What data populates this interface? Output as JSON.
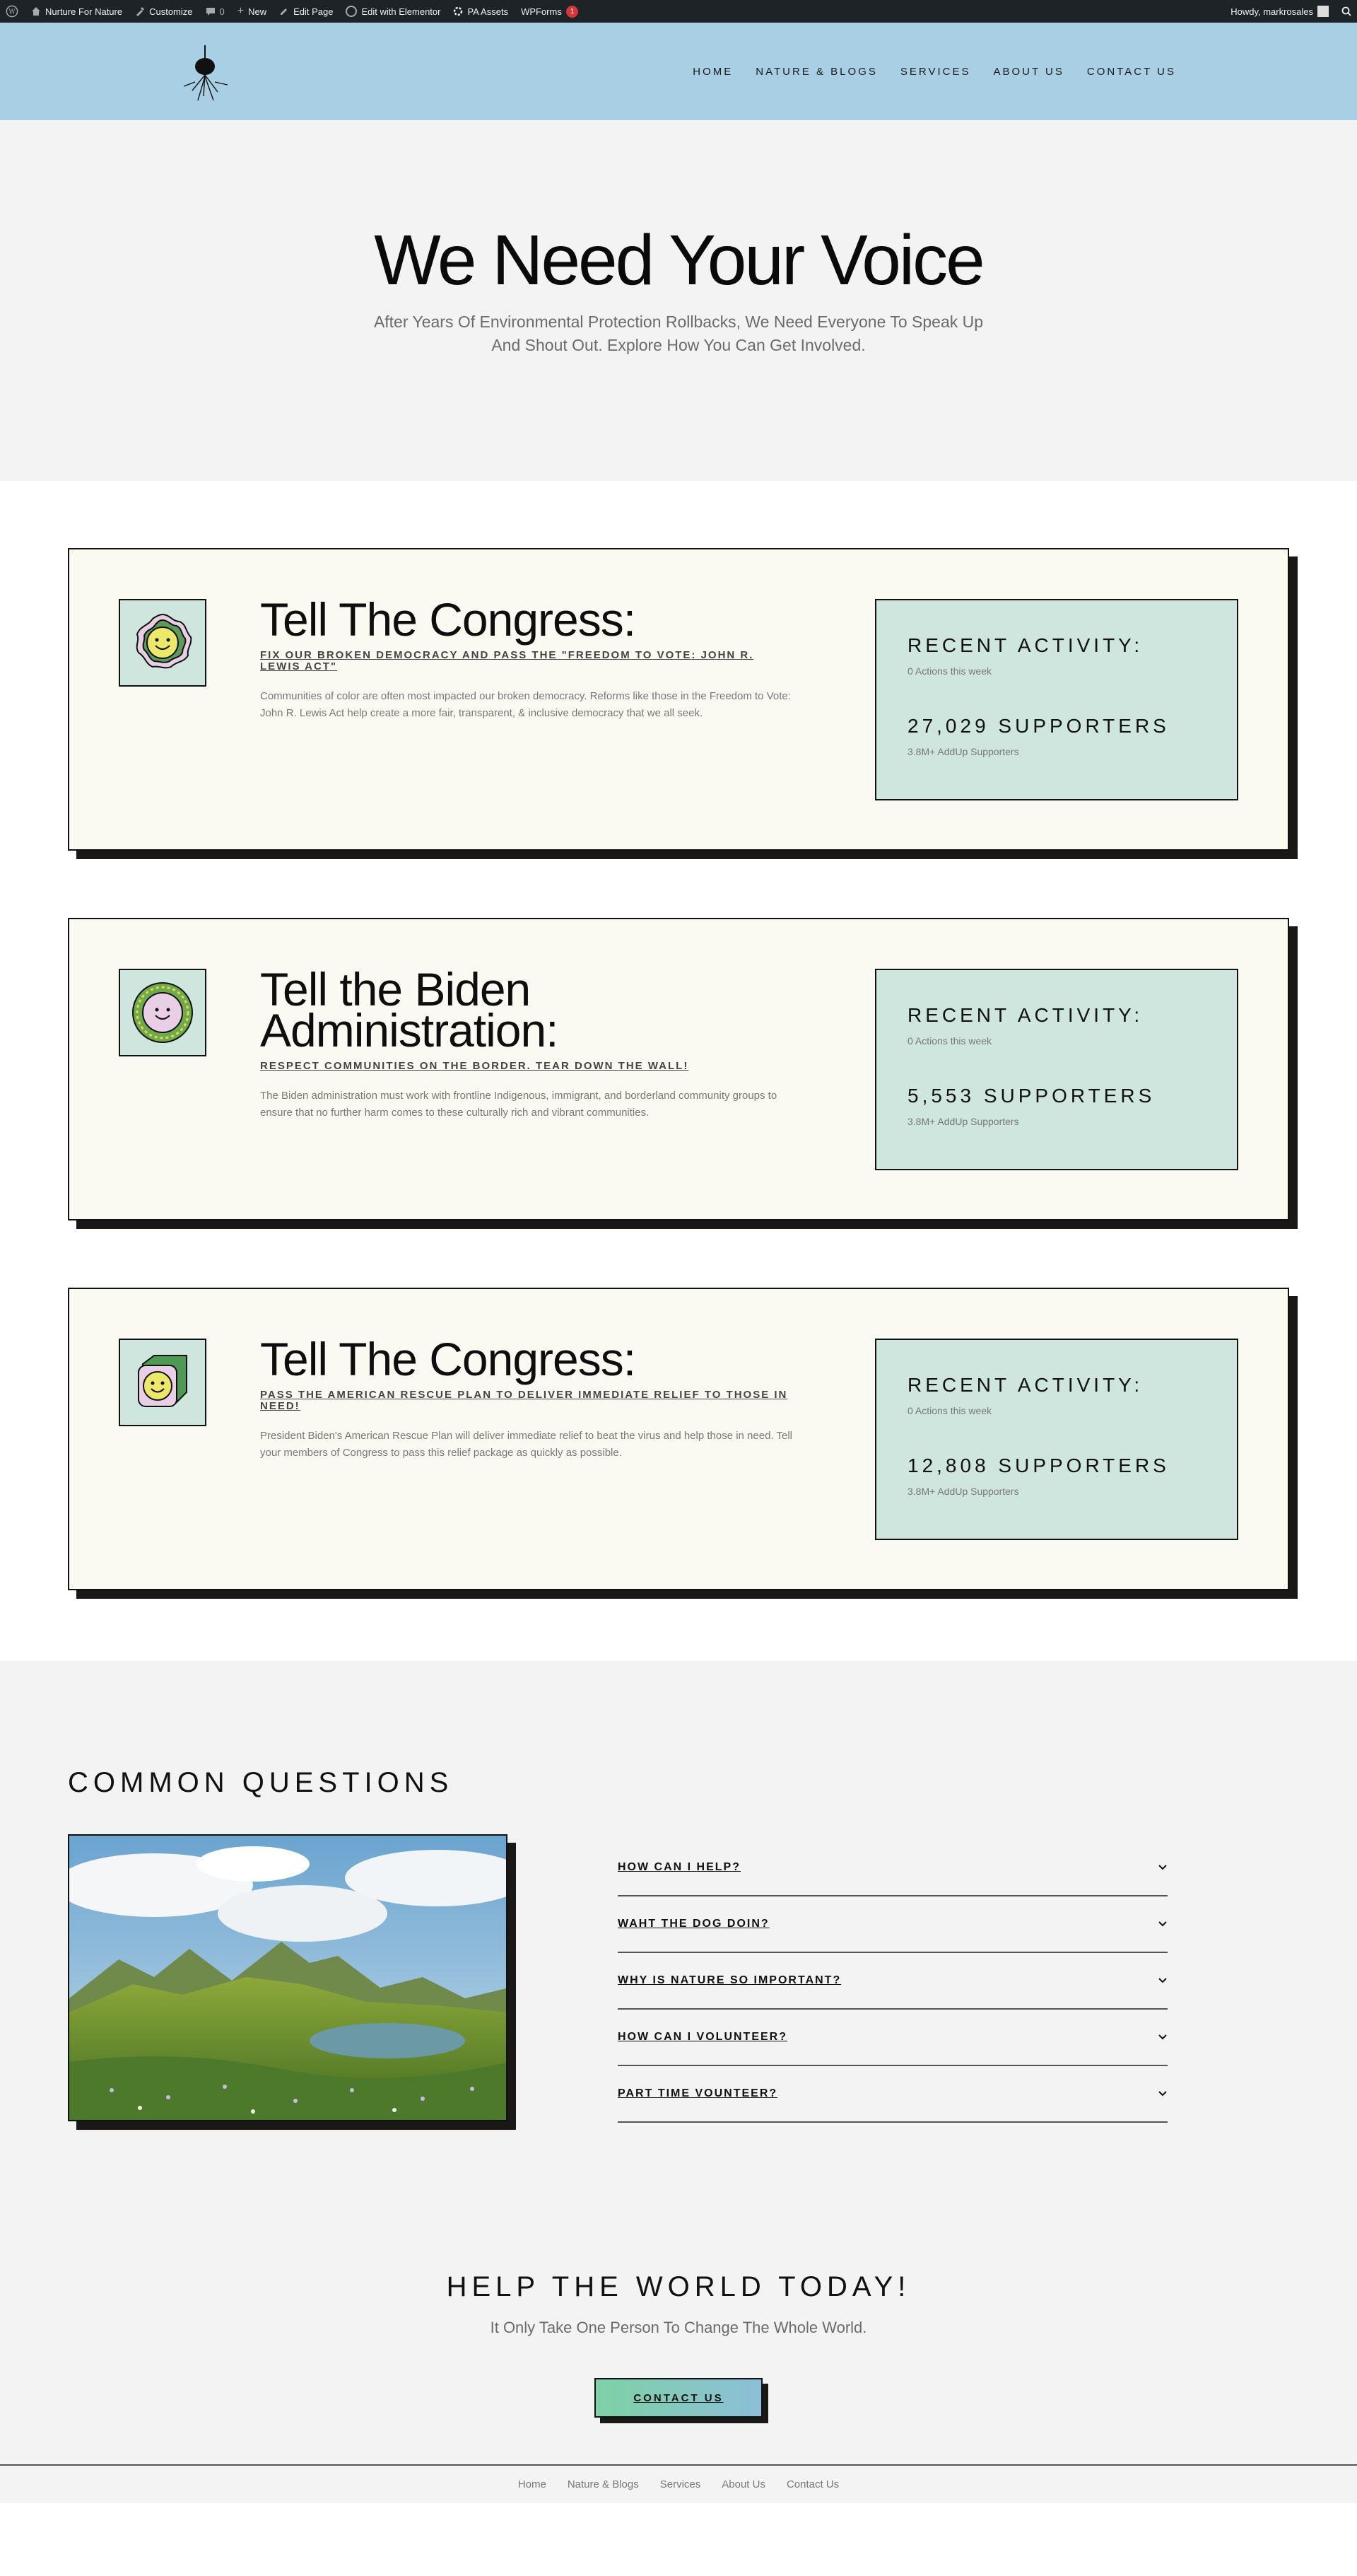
{
  "adminbar": {
    "site_name": "Nurture For Nature",
    "customize": "Customize",
    "comments": "0",
    "new": "New",
    "edit_page": "Edit Page",
    "edit_elementor": "Edit with Elementor",
    "pa_assets": "PA Assets",
    "wpforms": "WPForms",
    "wpforms_badge": "1",
    "howdy": "Howdy, markrosales"
  },
  "nav": {
    "items": [
      "Home",
      "Nature & Blogs",
      "Services",
      "About Us",
      "Contact Us"
    ]
  },
  "hero": {
    "title": "We Need Your Voice",
    "subtitle": "After Years Of Environmental Protection Rollbacks, We Need Everyone To Speak Up And Shout Out. Explore How You Can Get Involved."
  },
  "cards": [
    {
      "title": "Tell The Congress:",
      "subtitle": "Fix Our Broken Democracy and Pass the \"Freedom to Vote: John R. Lewis Act\"",
      "description": "Communities of color are often most impacted our broken democracy. Reforms like those in the Freedom to Vote: John R. Lewis Act help create a more fair, transparent, & inclusive democracy that we all seek.",
      "activity_label": "Recent Activity:",
      "actions": "0 Actions this week",
      "supporters": "27,029 SUPPORTERS",
      "addup": "3.8M+ AddUp Supporters"
    },
    {
      "title": "Tell the Biden Administration:",
      "subtitle": "Respect communities on the border. Tear down the wall!",
      "description": "The Biden administration must work with frontline Indigenous, immigrant, and borderland community groups to ensure that no further harm comes to these culturally rich and vibrant communities.",
      "activity_label": "Recent Activity:",
      "actions": "0 Actions this week",
      "supporters": "5,553 SUPPORTERS",
      "addup": "3.8M+ AddUp Supporters"
    },
    {
      "title": "Tell The Congress:",
      "subtitle": "Pass the American Rescue Plan to deliver immediate relief to those in need!",
      "description": "President Biden's American Rescue Plan will deliver immediate relief to beat the virus and help those in need. Tell your members of Congress to pass this relief package as quickly as possible.",
      "activity_label": "Recent Activity:",
      "actions": "0 Actions this week",
      "supporters": "12,808 SUPPORTERS",
      "addup": "3.8M+ AddUp Supporters"
    }
  ],
  "faq": {
    "title": "COMMON QUESTIONS",
    "items": [
      "How can I help?",
      "Waht the dog doin?",
      "Why is nature so important?",
      "How can I volunteer?",
      "Part time vounteer?"
    ]
  },
  "cta": {
    "title": "HELP THE WORLD TODAY!",
    "subtitle": "It Only Take One Person To Change The Whole World.",
    "button": "CONTACT US"
  },
  "footer": {
    "links": [
      "Home",
      "Nature & Blogs",
      "Services",
      "About Us",
      "Contact Us"
    ]
  },
  "colors": {
    "header_bg": "#a8cfe3",
    "card_bg": "#fbfaf2",
    "activity_bg": "#cfe6de",
    "admin_bg": "#1d2327"
  }
}
